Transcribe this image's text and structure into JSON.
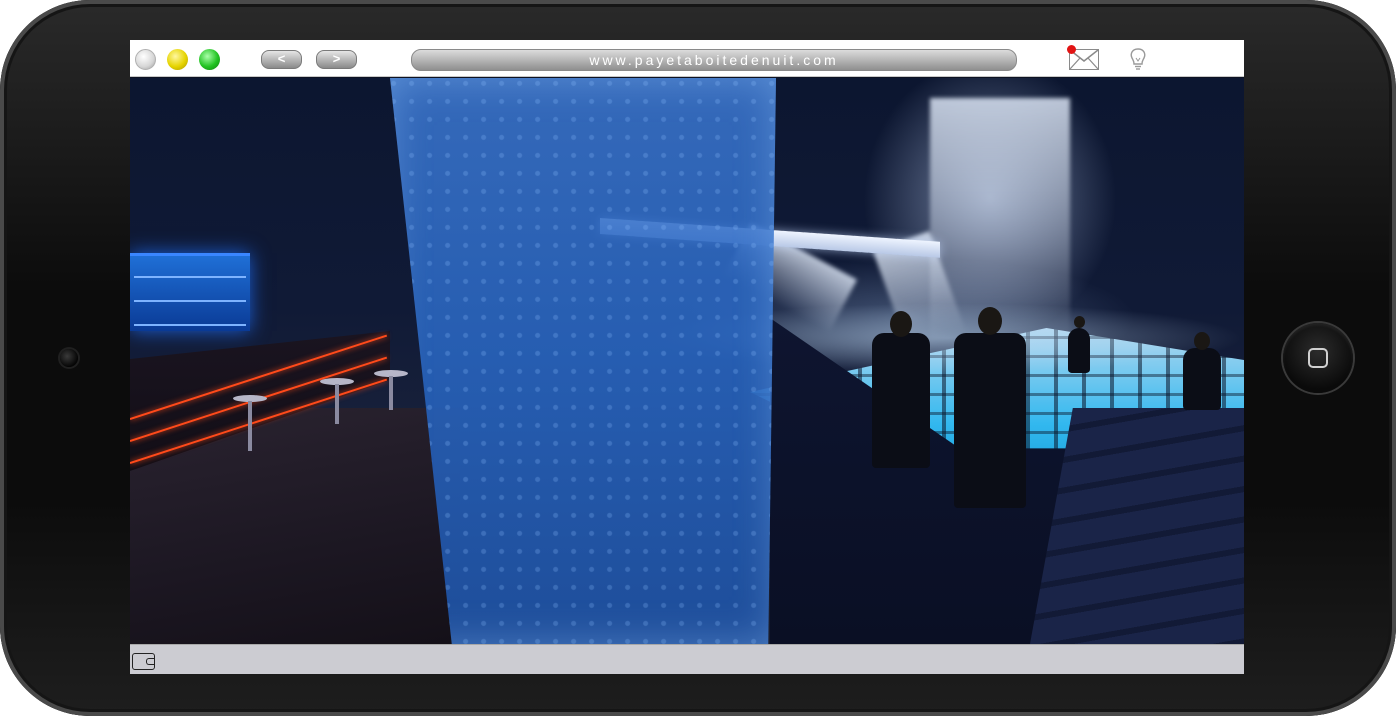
{
  "browser": {
    "url": "www.payetaboitedenuit.com",
    "back_label": "<",
    "forward_label": ">",
    "window_controls": [
      "white",
      "yellow",
      "green"
    ],
    "notifications": {
      "mail_icon": "mail-icon",
      "mail_unread_indicator_color": "#e21414",
      "bulb_icon": "lightbulb-icon"
    }
  },
  "status_bar": {
    "wallet_icon": "wallet-icon"
  },
  "device": {
    "type": "tablet",
    "home_button_icon": "home-button"
  },
  "scene": {
    "description_tag": "nightclub-game-scene"
  }
}
